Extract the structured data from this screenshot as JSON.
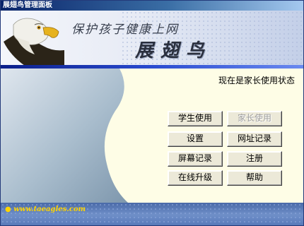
{
  "window": {
    "title": "展翅鸟管理面板"
  },
  "banner": {
    "slogan": "保护孩子健康上网",
    "brand": "展翅鸟"
  },
  "status_text": "现在是家长使用状态",
  "buttons": {
    "student": "学生使用",
    "parent": "家长使用",
    "settings": "设置",
    "url_log": "网址记录",
    "screen_log": "屏幕记录",
    "register": "注册",
    "online_upgrade": "在线升级",
    "help": "帮助"
  },
  "footer": {
    "url": "www.taeagles.com"
  },
  "colors": {
    "title_bar": "#0a246a",
    "accent_stripe": "#2a4bd0",
    "content_bg": "#fefde6",
    "footer_link": "#ffd400"
  },
  "icons": {
    "banner_logo": "eagle-icon",
    "footer_bullet": "dot-icon"
  }
}
